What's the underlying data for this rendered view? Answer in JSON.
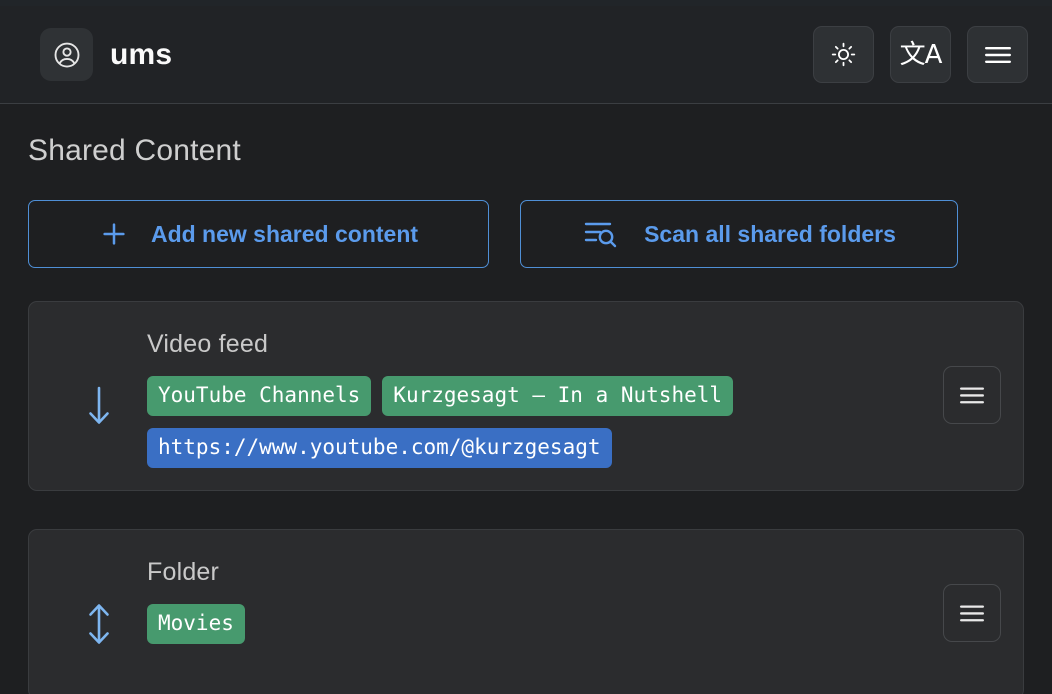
{
  "header": {
    "avatar_icon": "account-circle-icon",
    "title": "ums",
    "actions": [
      {
        "name": "theme-toggle-button",
        "icon": "sun-icon"
      },
      {
        "name": "language-button",
        "icon": "translate-icon",
        "glyph": "文A"
      },
      {
        "name": "menu-button",
        "icon": "hamburger-icon"
      }
    ]
  },
  "main": {
    "page_title": "Shared Content",
    "buttons": [
      {
        "name": "add-new-shared-content-button",
        "label": "Add new shared content",
        "icon": "plus-icon"
      },
      {
        "name": "scan-all-shared-folders-button",
        "label": "Scan all shared folders",
        "icon": "list-search-icon"
      }
    ],
    "cards": [
      {
        "name": "shared-content-card-video-feed",
        "arrow_icon": "arrow-down-icon",
        "kind": "Video feed",
        "badges": [
          {
            "text": "YouTube Channels",
            "color": "green"
          },
          {
            "text": "Kurzgesagt — In a Nutshell",
            "color": "green"
          },
          {
            "text": "https://www.youtube.com/@kurzgesagt",
            "color": "blue"
          }
        ],
        "menu_icon": "hamburger-icon"
      },
      {
        "name": "shared-content-card-folder",
        "arrow_icon": "arrow-up-down-icon",
        "kind": "Folder",
        "badges": [
          {
            "text": "Movies",
            "color": "green"
          }
        ],
        "menu_icon": "hamburger-icon"
      }
    ]
  },
  "colors": {
    "page_background": "#1e1f21",
    "header_background": "#212326",
    "card_background": "#2b2c2e",
    "accent_blue": "#5b9bec",
    "arrow_blue": "#7eb6f0",
    "badge_green": "#479a6e",
    "badge_blue": "#3a6fc4",
    "text_primary": "#dcdcdc"
  }
}
